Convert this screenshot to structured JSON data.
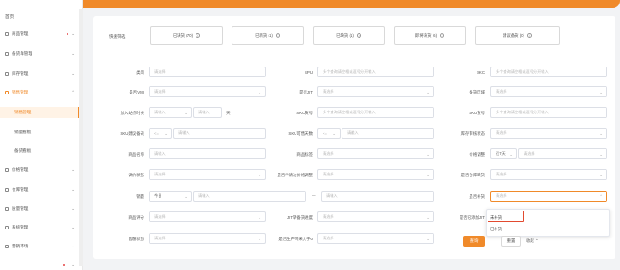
{
  "brand_color": "#f08a2a",
  "sidebar": {
    "items": [
      {
        "label": "首页"
      },
      {
        "label": "商品管理",
        "badge": true
      },
      {
        "label": "备货单管理"
      },
      {
        "label": "库存管理"
      },
      {
        "label": "销售管理"
      },
      {
        "label": "销售管理"
      },
      {
        "label": "销量看板"
      },
      {
        "label": "备货看板"
      },
      {
        "label": "价格管理"
      },
      {
        "label": "仓库管理"
      },
      {
        "label": "质量管理"
      },
      {
        "label": "系统管理"
      },
      {
        "label": "营销市场"
      }
    ]
  },
  "quick_filter": {
    "label": "快速筛选",
    "buttons": [
      {
        "label": "已缺货 (70)"
      },
      {
        "label": "已断货 (1)"
      },
      {
        "label": "已缺货 (1)"
      },
      {
        "label": "即将缺货 (6)"
      },
      {
        "label": "建议备货 (0)"
      }
    ]
  },
  "form": {
    "f1": {
      "label": "类目",
      "placeholder": "请选择"
    },
    "f2": {
      "label": "SPU",
      "placeholder": "多个查询请空格或逗号分开输入"
    },
    "f3": {
      "label": "SKC",
      "placeholder": "多个查询请空格或逗号分开输入"
    },
    "f4": {
      "label": "是否VMI",
      "placeholder": "请选择"
    },
    "f5": {
      "label": "是否JIT",
      "placeholder": "请选择"
    },
    "f6": {
      "label": "备货区域",
      "placeholder": "请选择"
    },
    "f7": {
      "label": "加入站点时长",
      "placeholder_a": "请输入",
      "placeholder_b": "请输入",
      "unit": "天"
    },
    "f8": {
      "label": "SKC货号",
      "placeholder": "多个查询请空格或逗号分开输入"
    },
    "f9": {
      "label": "SKU货号",
      "placeholder": "多个查询请空格或逗号分开输入"
    },
    "f10": {
      "label": "SKU建议备货",
      "op": "<=",
      "placeholder": "请输入"
    },
    "f11": {
      "label": "SKU可售天数",
      "op": "<=",
      "placeholder": "请输入"
    },
    "f12": {
      "label": "库存审核状态",
      "placeholder": "请选择"
    },
    "f13": {
      "label": "商品名称",
      "placeholder": "请输入"
    },
    "f14": {
      "label": "商品标签",
      "placeholder": "请选择"
    },
    "f15": {
      "label": "价格调整",
      "period": "近7天",
      "placeholder": "请选择"
    },
    "f16": {
      "label": "调价状态",
      "placeholder": "请选择"
    },
    "f17": {
      "label": "是否申请过价格调整",
      "placeholder": "请选择"
    },
    "f18": {
      "label": "是否仓库缺货",
      "placeholder": "请选择"
    },
    "f19": {
      "label": "销量",
      "period": "今日",
      "placeholder_a": "请输入",
      "placeholder_b": "请输入"
    },
    "f20": {
      "label": "是否补货",
      "placeholder": "请选择"
    },
    "f21": {
      "label": "商品评分",
      "placeholder": "请选择"
    },
    "f22": {
      "label": "JIT转备货进度",
      "placeholder": "请选择"
    },
    "f23": {
      "label": "是否已添加JIT",
      "placeholder": "请选择"
    },
    "f24": {
      "label": "售罄状态",
      "placeholder": "请选择"
    },
    "f25": {
      "label": "是否生产转采大于0",
      "placeholder": "请选择"
    }
  },
  "dropdown": {
    "options": [
      "未补货",
      "已补货"
    ]
  },
  "actions": {
    "search": "查询",
    "reset": "重置",
    "collapse": "收起"
  }
}
